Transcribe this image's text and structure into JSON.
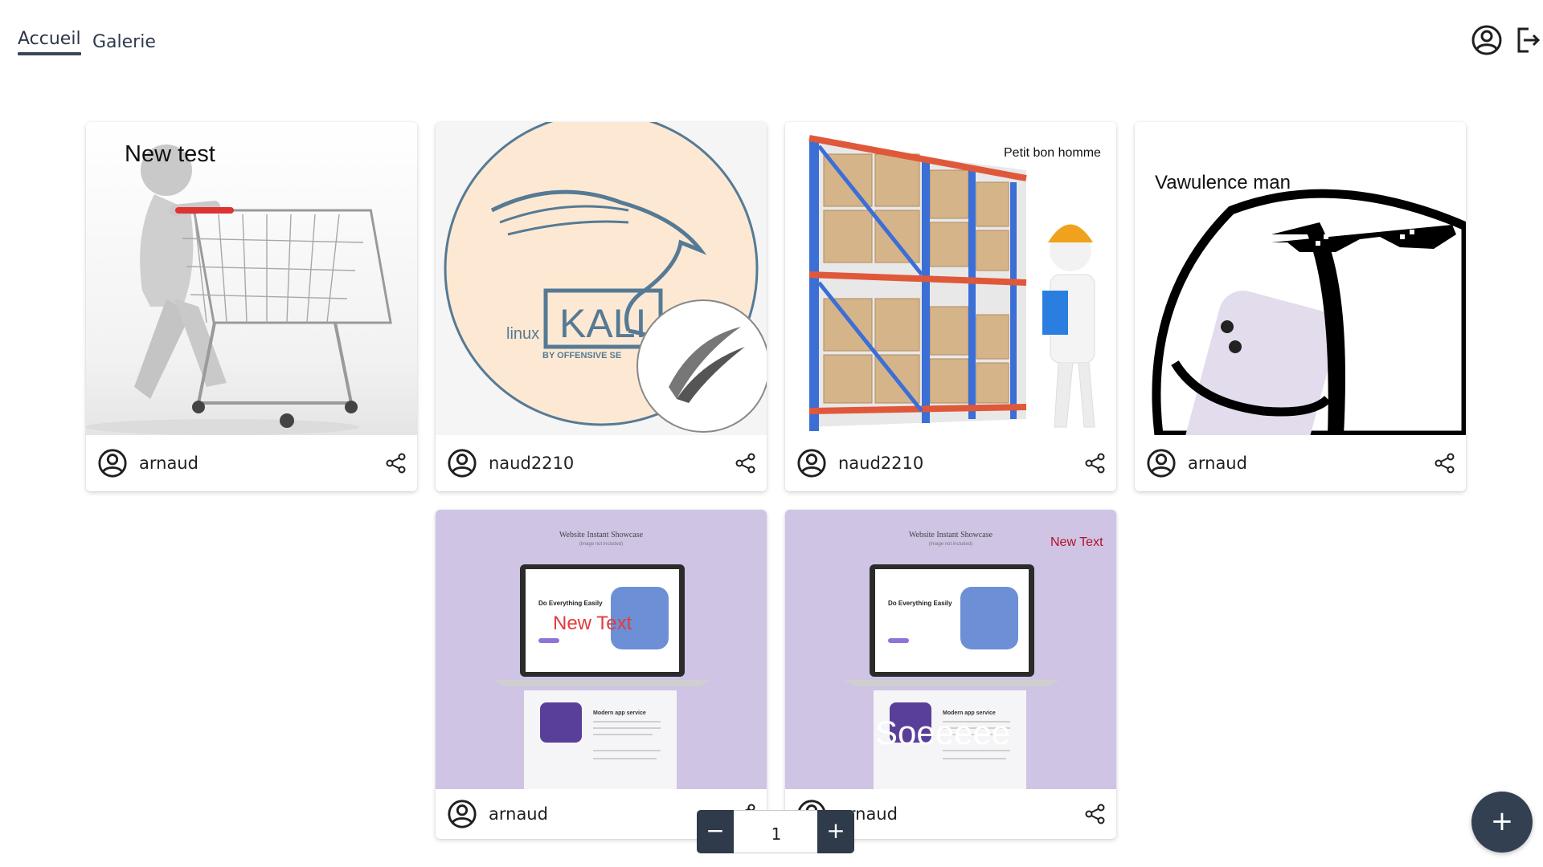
{
  "nav": {
    "tabs": [
      {
        "label": "Accueil",
        "active": true
      },
      {
        "label": "Galerie",
        "active": false
      }
    ],
    "icons": [
      "user-circle-icon",
      "logout-icon"
    ]
  },
  "cards": [
    {
      "user": "arnaud",
      "overlay": "New test",
      "image": "figure-with-shopping-cart"
    },
    {
      "user": "naud2210",
      "overlay": "",
      "image": "kali-linux-logo",
      "logo_text": "KALI",
      "logo_prefix": "linux",
      "logo_sub": "BY OFFENSIVE SE"
    },
    {
      "user": "naud2210",
      "overlay": "Petit bon homme",
      "image": "warehouse-worker-shelves"
    },
    {
      "user": "arnaud",
      "overlay": "Vawulence man",
      "image": "meme-face-sunglasses-phone"
    },
    {
      "user": "arnaud",
      "overlay": "New Text",
      "image": "laptop-mockup-lavender",
      "mockup_title": "Website Instant Showcase",
      "mockup_sub": "(image not included)",
      "mockup_head": "Do Everything Easily",
      "mockup_sec": "Modern app service"
    },
    {
      "user": "arnaud",
      "overlay": "New Text",
      "overlay2": "Soeeeee",
      "image": "laptop-mockup-lavender",
      "mockup_title": "Website Instant Showcase",
      "mockup_sub": "(image not included)",
      "mockup_head": "Do Everything Easily",
      "mockup_sec": "Modern app service"
    }
  ],
  "pager": {
    "minus": "−",
    "value": "1",
    "plus": "+"
  },
  "fab": {
    "label": "+"
  },
  "colors": {
    "primary": "#2f3a4b",
    "mockup_bg": "#cfc4e4",
    "kali_bg": "#fde9d3"
  }
}
